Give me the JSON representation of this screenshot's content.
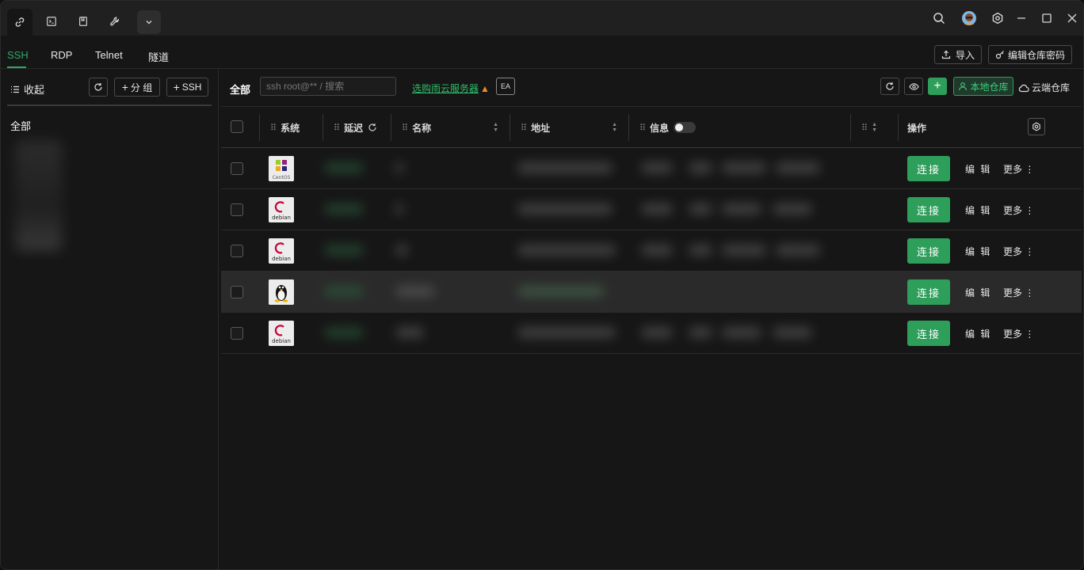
{
  "titlebar": {
    "tab_icons": [
      "link-icon",
      "terminal-icon",
      "bookmark-icon",
      "wrench-icon",
      "chevron-down-icon"
    ],
    "right_icons": [
      "search-icon",
      "avatar",
      "settings-icon",
      "minimize-icon",
      "maximize-icon",
      "close-icon"
    ]
  },
  "protocol_tabs": [
    "SSH",
    "RDP",
    "Telnet",
    "隧道"
  ],
  "top_actions": {
    "import_label": "导入",
    "edit_repo_password_label": "编辑仓库密码"
  },
  "sidebar": {
    "collapse_label": "收起",
    "add_group_label": "分 组",
    "add_ssh_label": "SSH",
    "all_label": "全部"
  },
  "main": {
    "all_label": "全部",
    "search_placeholder": "ssh root@** / 搜索",
    "buy_link": "选购雨云服务器",
    "ea_label": "EA",
    "local_repo_label": "本地仓库",
    "cloud_repo_label": "云端仓库"
  },
  "table": {
    "headers": {
      "system": "系统",
      "latency": "延迟",
      "name": "名称",
      "address": "地址",
      "info": "信息",
      "actions": "操作"
    },
    "rows": [
      {
        "os": "CentOS",
        "connect": "连接",
        "edit": "编 辑",
        "more": "更多 ⋮"
      },
      {
        "os": "debian",
        "connect": "连接",
        "edit": "编 辑",
        "more": "更多 ⋮"
      },
      {
        "os": "debian",
        "connect": "连接",
        "edit": "编 辑",
        "more": "更多 ⋮"
      },
      {
        "os": "linux",
        "connect": "连接",
        "edit": "编 辑",
        "more": "更多 ⋮"
      },
      {
        "os": "debian",
        "connect": "连接",
        "edit": "编 辑",
        "more": "更多 ⋮"
      }
    ]
  },
  "colors": {
    "accent": "#2e9e5b",
    "link": "#2fbf6a",
    "bg": "#161616"
  }
}
